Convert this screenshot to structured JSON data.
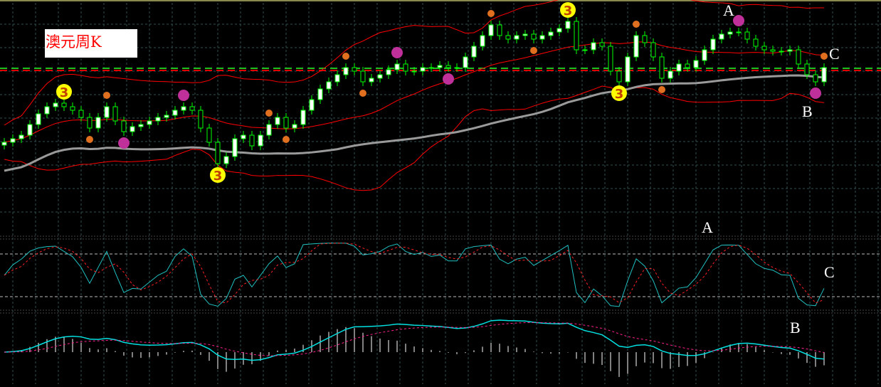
{
  "title_label": "澳元周K",
  "annotations": {
    "main_a": "A",
    "main_b": "B",
    "main_c": "C",
    "osc_a": "A",
    "osc_b": "B",
    "osc_c": "C"
  },
  "colors": {
    "up_fill": "#ffffff",
    "candle": "#00ff00",
    "band": "#ff0000",
    "ma": "#9a9a9a",
    "grid": "#2f4f4f",
    "stoch_main": "#20c0c0",
    "stoch_signal": "#ff2020",
    "macd_main": "#00e0e0",
    "macd_signal": "#ff2090",
    "hist": "#ffffff",
    "level_green": "#20c020",
    "level_red": "#e00000",
    "marker_yellow": "#ffff00",
    "marker_magenta": "#c0309a",
    "marker_orange": "#e07020"
  },
  "chart_data": {
    "type": "candlestick",
    "title": "澳元周K",
    "closes": [
      100,
      105,
      110,
      125,
      140,
      150,
      155,
      150,
      145,
      135,
      120,
      135,
      150,
      130,
      115,
      122,
      125,
      130,
      135,
      138,
      145,
      150,
      145,
      120,
      100,
      70,
      80,
      105,
      110,
      95,
      110,
      125,
      135,
      120,
      125,
      145,
      160,
      175,
      185,
      195,
      205,
      200,
      185,
      190,
      195,
      202,
      210,
      200,
      200,
      205,
      205,
      208,
      205,
      205,
      220,
      235,
      250,
      265,
      250,
      245,
      250,
      252,
      245,
      250,
      255,
      260,
      270,
      230,
      230,
      240,
      235,
      200,
      185,
      220,
      250,
      240,
      220,
      190,
      200,
      210,
      205,
      215,
      230,
      245,
      252,
      255,
      255,
      245,
      235,
      230,
      228,
      228,
      230,
      210,
      195,
      185,
      205
    ],
    "indicators": {
      "bollinger_period": 20,
      "bollinger_dev": 2,
      "ma_period": 40,
      "stochastic_period": 14,
      "stochastic_levels": [
        80,
        20
      ],
      "macd": [
        12,
        26,
        9
      ]
    },
    "levels": [
      204,
      201
    ],
    "markers": [
      {
        "index": 7,
        "type": "yellow",
        "label": "3",
        "pos": "above"
      },
      {
        "index": 25,
        "type": "yellow",
        "label": "3",
        "pos": "below"
      },
      {
        "index": 66,
        "type": "yellow",
        "label": "3",
        "pos": "above"
      },
      {
        "index": 72,
        "type": "yellow",
        "label": "3",
        "pos": "below"
      },
      {
        "index": 14,
        "type": "magenta",
        "pos": "below"
      },
      {
        "index": 21,
        "type": "magenta",
        "pos": "above"
      },
      {
        "index": 46,
        "type": "magenta",
        "pos": "above"
      },
      {
        "index": 52,
        "type": "magenta",
        "pos": "below"
      },
      {
        "index": 86,
        "type": "magenta",
        "pos": "above"
      },
      {
        "index": 95,
        "type": "magenta",
        "pos": "below"
      },
      {
        "index": 10,
        "type": "orange",
        "pos": "below"
      },
      {
        "index": 12,
        "type": "orange",
        "pos": "above"
      },
      {
        "index": 31,
        "type": "orange",
        "pos": "above"
      },
      {
        "index": 33,
        "type": "orange",
        "pos": "below"
      },
      {
        "index": 40,
        "type": "orange",
        "pos": "above"
      },
      {
        "index": 42,
        "type": "orange",
        "pos": "below"
      },
      {
        "index": 57,
        "type": "orange",
        "pos": "above"
      },
      {
        "index": 62,
        "type": "orange",
        "pos": "below"
      },
      {
        "index": 74,
        "type": "orange",
        "pos": "above"
      },
      {
        "index": 77,
        "type": "orange",
        "pos": "below"
      },
      {
        "index": 96,
        "type": "orange",
        "pos": "above"
      }
    ]
  }
}
